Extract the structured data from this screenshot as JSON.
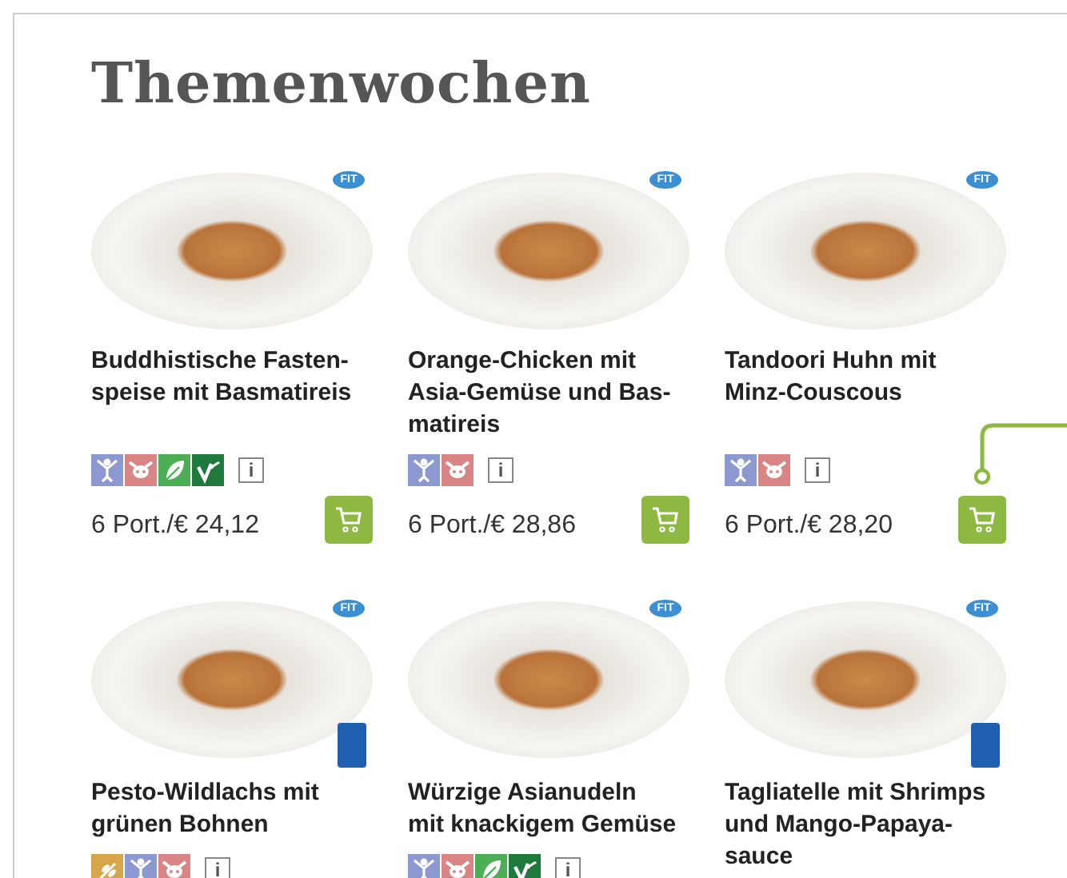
{
  "heading": "Themenwochen",
  "products": [
    {
      "name": "Buddhistische Fasten-speise mit Basmatireis",
      "badge": "FIT",
      "icons": [
        {
          "kind": "figure"
        },
        {
          "kind": "animal"
        },
        {
          "kind": "leaf"
        },
        {
          "kind": "vegan"
        }
      ],
      "info": "i",
      "price": "6 Port./€ 24,12"
    },
    {
      "name": "Orange-Chicken mit Asia-Gemüse und Bas-matireis",
      "badge": "FIT",
      "icons": [
        {
          "kind": "figure"
        },
        {
          "kind": "animal"
        }
      ],
      "info": "i",
      "price": "6 Port./€ 28,86"
    },
    {
      "name": "Tandoori Huhn mit Minz-Couscous",
      "badge": "FIT",
      "icons": [
        {
          "kind": "figure"
        },
        {
          "kind": "animal"
        }
      ],
      "info": "i",
      "price": "6 Port./€ 28,20"
    },
    {
      "name": "Pesto-Wildlachs mit grünen Bohnen",
      "badge": "FIT",
      "seal": {
        "kind": "fish"
      },
      "icons": [
        {
          "kind": "grain"
        },
        {
          "kind": "figure"
        },
        {
          "kind": "animal"
        }
      ],
      "info": "i"
    },
    {
      "name": "Würzige Asianudeln mit knackigem Gemüse",
      "badge": "FIT",
      "icons": [
        {
          "kind": "figure"
        },
        {
          "kind": "animal"
        },
        {
          "kind": "leaf"
        },
        {
          "kind": "vegan"
        }
      ],
      "info": "i"
    },
    {
      "name": "Tagliatelle mit Shrimps und Mango-Papaya-sauce",
      "badge": "FIT",
      "seal": {
        "kind": "fish"
      }
    }
  ]
}
